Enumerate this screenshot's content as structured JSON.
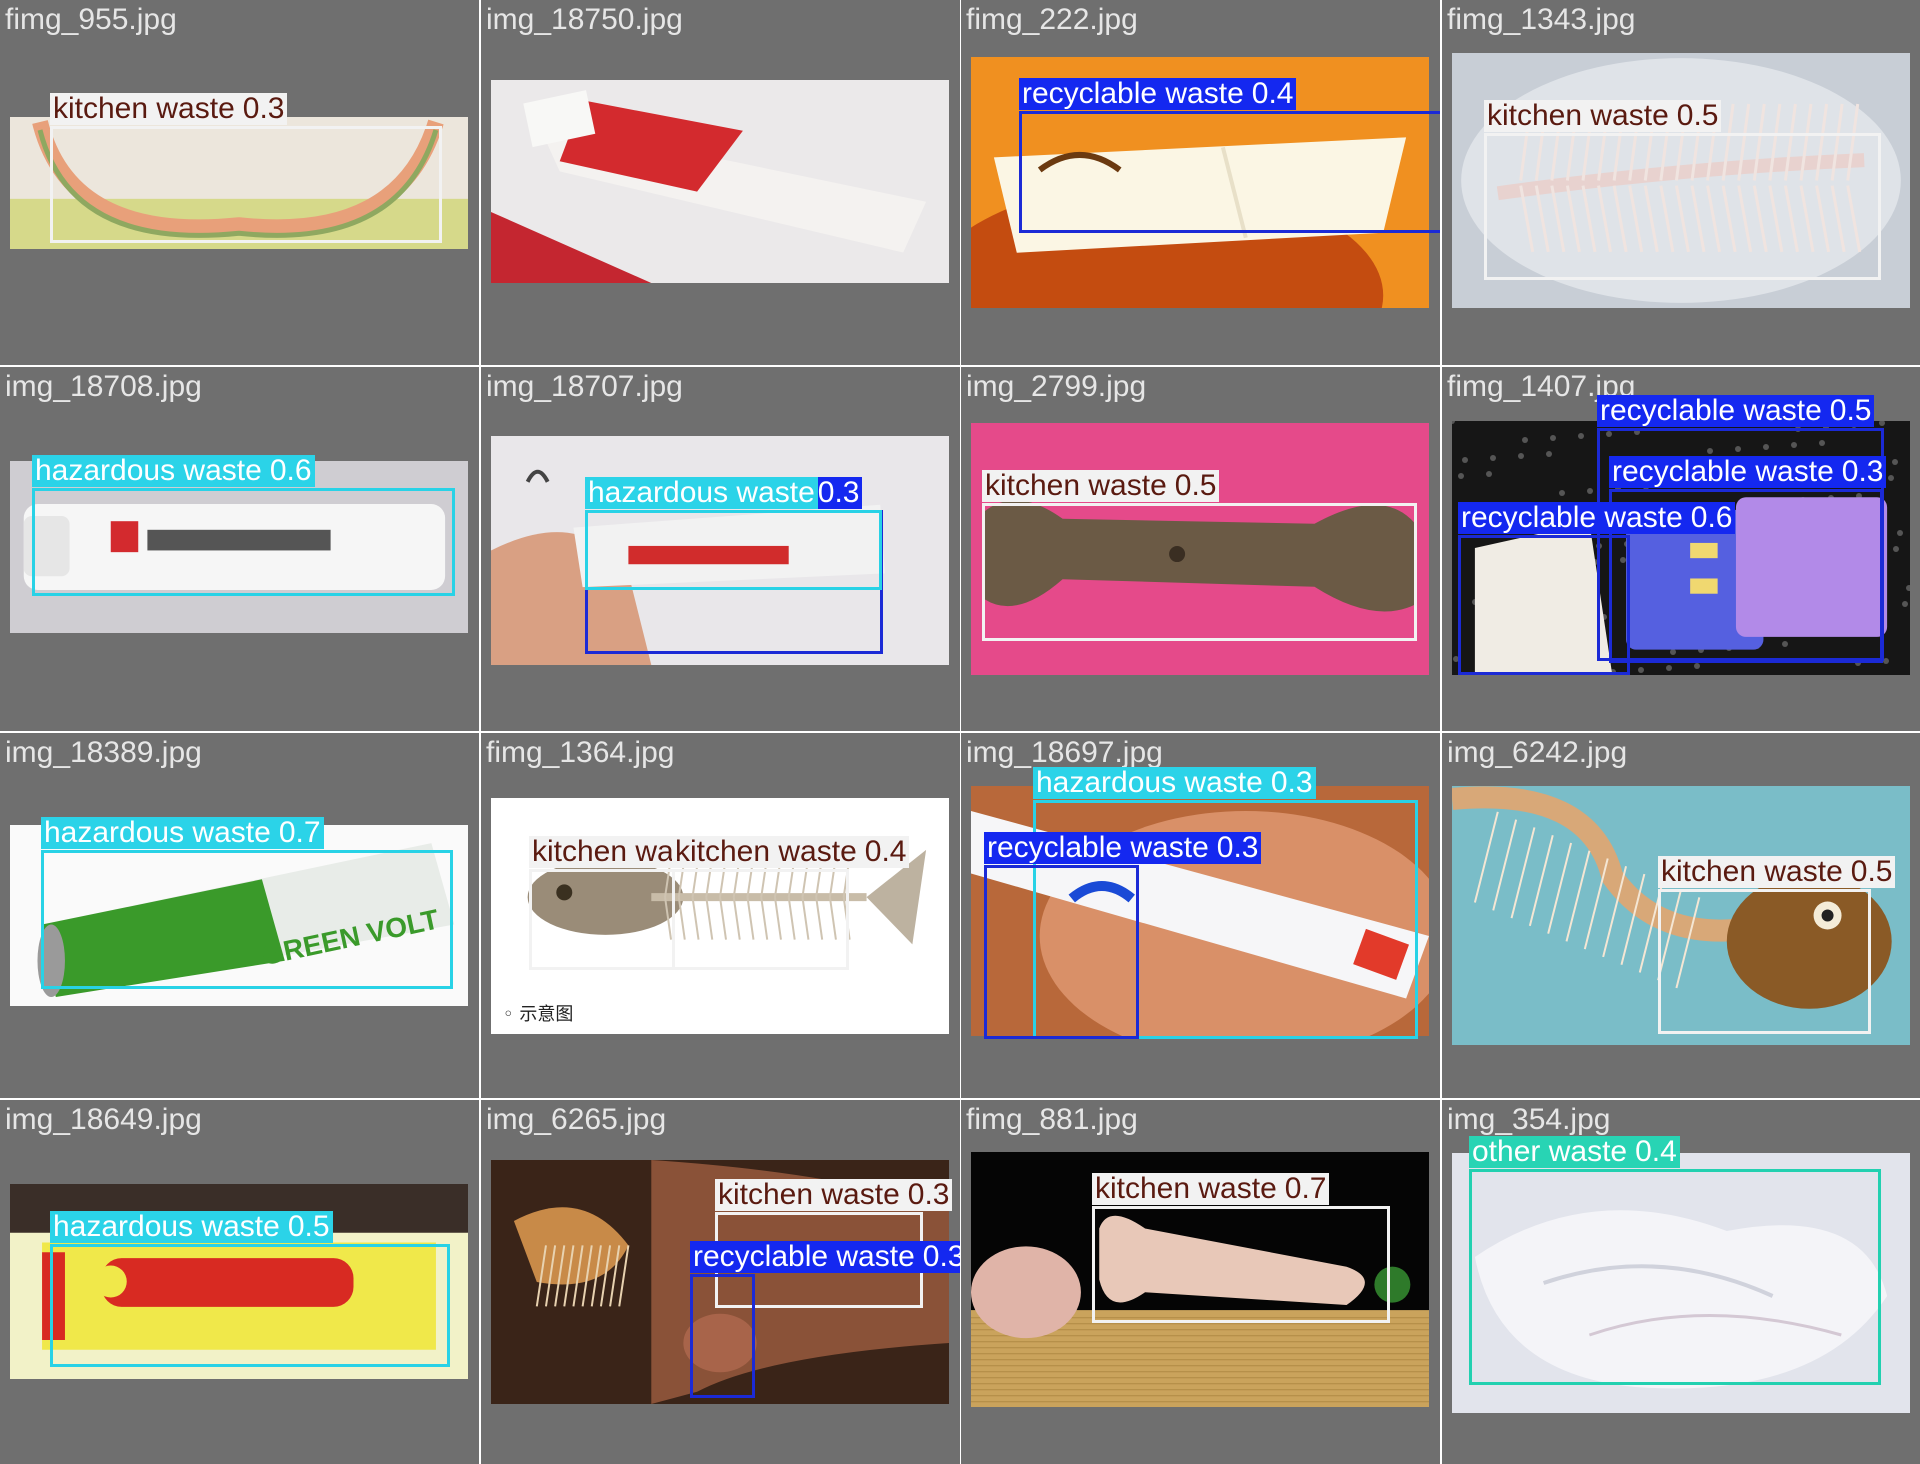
{
  "colors": {
    "kitchen waste": {
      "box": "#f2f2f2",
      "label_bg": "#f2f2f2",
      "label_fg": "#5a1a10"
    },
    "recyclable waste": {
      "box": "#1b2ad6",
      "label_bg": "#1428f0",
      "label_fg": "#ffffff"
    },
    "hazardous waste": {
      "box": "#28d2e6",
      "label_bg": "#2bd3e8",
      "label_fg": "#ffffff"
    },
    "other waste": {
      "box": "#22d0b0",
      "label_bg": "#28d4b4",
      "label_fg": "#ffffff"
    },
    "tile_bg": "#6f6f6f"
  },
  "tiles": [
    {
      "file": "fimg_955.jpg",
      "scene": "watermelon-rind",
      "dets": [
        {
          "cls": "kitchen waste",
          "conf": "0.3"
        }
      ]
    },
    {
      "file": "img_18750.jpg",
      "scene": "ointment-tube-red",
      "dets": []
    },
    {
      "file": "fimg_222.jpg",
      "scene": "foam-food-box",
      "dets": [
        {
          "cls": "recyclable waste",
          "conf": "0.4"
        }
      ]
    },
    {
      "file": "fimg_1343.jpg",
      "scene": "fish-bone",
      "dets": [
        {
          "cls": "kitchen waste",
          "conf": "0.5"
        }
      ]
    },
    {
      "file": "img_18708.jpg",
      "scene": "ointment-tube-white",
      "dets": [
        {
          "cls": "hazardous waste",
          "conf": "0.6"
        }
      ]
    },
    {
      "file": "img_18707.jpg",
      "scene": "ointment-in-hand",
      "dets": [
        {
          "cls": "recyclable waste",
          "conf": "0.3"
        },
        {
          "cls": "hazardous waste",
          "conf": ""
        }
      ]
    },
    {
      "file": "img_2799.jpg",
      "scene": "bone-on-pink",
      "dets": [
        {
          "cls": "kitchen waste",
          "conf": "0.5"
        }
      ]
    },
    {
      "file": "fimg_1407.jpg",
      "scene": "battery-pack",
      "dets": [
        {
          "cls": "recyclable waste",
          "conf": "0.5"
        },
        {
          "cls": "recyclable waste",
          "conf": "0.3"
        },
        {
          "cls": "recyclable waste",
          "conf": "0.6"
        }
      ]
    },
    {
      "file": "img_18389.jpg",
      "scene": "green-battery",
      "dets": [
        {
          "cls": "hazardous waste",
          "conf": "0.7"
        }
      ]
    },
    {
      "file": "fimg_1364.jpg",
      "scene": "fish-skeleton",
      "dets": [
        {
          "cls": "kitchen waste",
          "conf": "0.4"
        },
        {
          "cls": "kitchen waste",
          "conf": "0.4"
        }
      ],
      "caption": "◦ 示意图"
    },
    {
      "file": "img_18697.jpg",
      "scene": "ointment-in-hand-2",
      "dets": [
        {
          "cls": "hazardous waste",
          "conf": "0.3"
        },
        {
          "cls": "recyclable waste",
          "conf": "0.3"
        }
      ]
    },
    {
      "file": "img_6242.jpg",
      "scene": "fish-head",
      "dets": [
        {
          "cls": "kitchen waste",
          "conf": "0.5"
        }
      ]
    },
    {
      "file": "img_18649.jpg",
      "scene": "ointment-yellow",
      "dets": [
        {
          "cls": "hazardous waste",
          "conf": "0.5"
        }
      ]
    },
    {
      "file": "img_6265.jpg",
      "scene": "fish-in-hand",
      "dets": [
        {
          "cls": "kitchen waste",
          "conf": "0.3"
        },
        {
          "cls": "recyclable waste",
          "conf": "0.3"
        }
      ]
    },
    {
      "file": "fimg_881.jpg",
      "scene": "bone-on-board",
      "dets": [
        {
          "cls": "kitchen waste",
          "conf": "0.7"
        }
      ]
    },
    {
      "file": "img_354.jpg",
      "scene": "plastic-bag",
      "dets": [
        {
          "cls": "other waste",
          "conf": "0.4"
        }
      ]
    }
  ]
}
